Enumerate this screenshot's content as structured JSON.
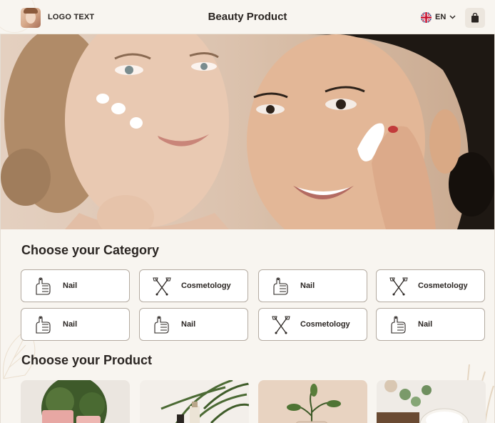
{
  "header": {
    "logo_text": "LOGO TEXT",
    "title": "Beauty Product",
    "language": "EN",
    "language_flag": "uk-flag-icon",
    "cart_icon": "shopping-bag-icon"
  },
  "hero": {
    "image": "two-women-applying-face-cream"
  },
  "categories": {
    "title": "Choose your Category",
    "items": [
      {
        "label": "Nail",
        "icon": "nail-hand-icon"
      },
      {
        "label": "Cosmetology",
        "icon": "cosmetology-tools-icon"
      },
      {
        "label": "Nail",
        "icon": "nail-hand-icon"
      },
      {
        "label": "Cosmetology",
        "icon": "cosmetology-tools-icon"
      },
      {
        "label": "Nail",
        "icon": "nail-hand-icon"
      },
      {
        "label": "Nail",
        "icon": "nail-hand-icon"
      },
      {
        "label": "Cosmetology",
        "icon": "cosmetology-tools-icon"
      },
      {
        "label": "Nail",
        "icon": "nail-hand-icon"
      }
    ]
  },
  "products": {
    "title": "Choose your Product",
    "items": [
      {
        "image": "pink-tube-with-greenery"
      },
      {
        "image": "palm-leaves-with-bottles"
      },
      {
        "image": "plant-in-glass-vase"
      },
      {
        "image": "cream-jar-with-eucalyptus"
      }
    ]
  },
  "colors": {
    "background": "#f8f5f0",
    "card_border": "#b3aaa0",
    "text": "#2a2522"
  }
}
